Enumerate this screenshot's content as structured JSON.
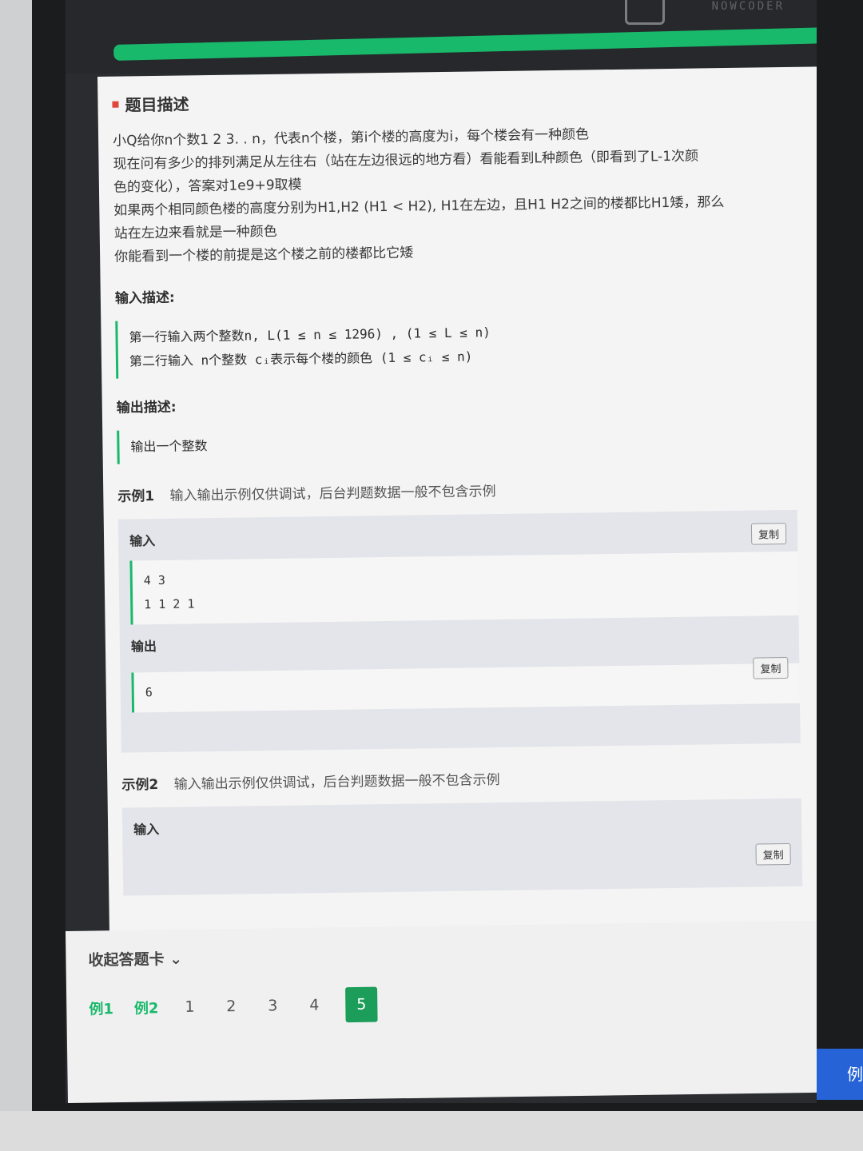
{
  "site": {
    "logo_text": "NOWCODER"
  },
  "problem": {
    "section_title": "题目描述",
    "description": [
      "小Q给你n个数1 2 3. . n，代表n个楼，第i个楼的高度为i，每个楼会有一种颜色",
      "现在问有多少的排列满足从左往右（站在左边很远的地方看）看能看到L种颜色（即看到了L-1次颜",
      "色的变化），答案对1e9+9取模",
      "如果两个相同颜色楼的高度分别为H1,H2 (H1 < H2), H1在左边，且H1 H2之间的楼都比H1矮，那么",
      "站在左边来看就是一种颜色",
      "你能看到一个楼的前提是这个楼之前的楼都比它矮"
    ],
    "input_label": "输入描述:",
    "input_lines": [
      "第一行输入两个整数n, L(1 ≤ n ≤ 1296) , (1 ≤ L ≤ n)",
      "第二行输入 n个整数 cᵢ表示每个楼的颜色 (1 ≤ cᵢ ≤ n)"
    ],
    "output_label": "输出描述:",
    "output_lines": [
      "输出一个整数"
    ]
  },
  "examples": [
    {
      "title": "示例1",
      "note": "输入输出示例仅供调试，后台判题数据一般不包含示例",
      "input_label": "输入",
      "input_lines": [
        "4 3",
        "1 1 2 1"
      ],
      "output_label": "输出",
      "output_lines": [
        "6"
      ],
      "copy_label": "复制"
    },
    {
      "title": "示例2",
      "note": "输入输出示例仅供调试，后台判题数据一般不包含示例",
      "input_label": "输入",
      "copy_label": "复制"
    }
  ],
  "answer_card": {
    "collapse_label": "收起答题卡 ⌄",
    "tabs": [
      "例1",
      "例2"
    ],
    "pages": [
      "1",
      "2",
      "3",
      "4",
      "5"
    ],
    "active_page": "5"
  },
  "side_button": {
    "label": "例"
  },
  "colors": {
    "accent_green": "#19b96b",
    "active_page_bg": "#1c9e5a",
    "blue_button": "#2563d6",
    "title_dot": "#e0463b"
  }
}
